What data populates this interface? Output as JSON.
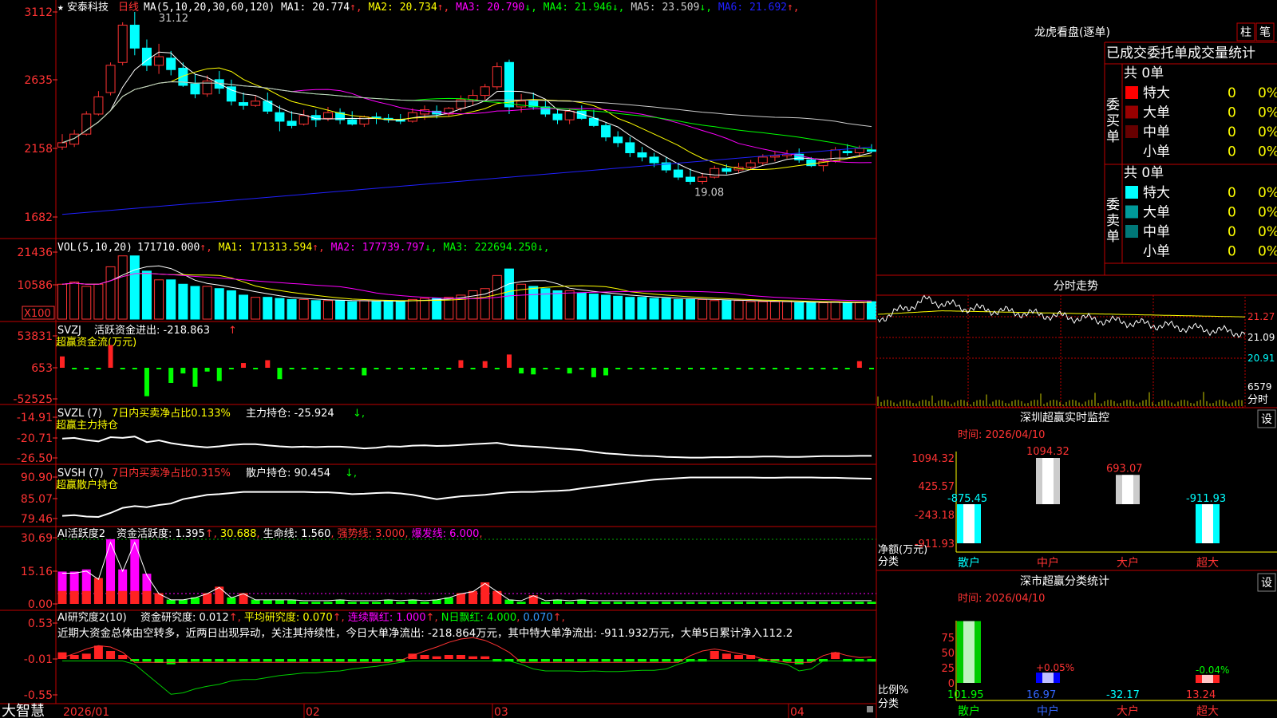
{
  "stock": {
    "star": "★",
    "name": "安泰科技",
    "period": "日线"
  },
  "price_panel": {
    "ma_label": "MA(5,10,20,30,60,120)",
    "ma_items": [
      {
        "text": "MA1: 20.774",
        "arrow": "↑",
        "color": "#ffffff"
      },
      {
        "text": "MA2: 20.734",
        "arrow": "↑",
        "color": "#ffff00"
      },
      {
        "text": "MA3: 20.790",
        "arrow": "↓",
        "color": "#ff00ff"
      },
      {
        "text": "MA4: 21.946",
        "arrow": "↓",
        "color": "#00ff00"
      },
      {
        "text": "MA5: 23.509",
        "arrow": "↓",
        "color": "#cccccc"
      },
      {
        "text": "MA6: 21.692",
        "arrow": "↑",
        "color": "#2020ff"
      }
    ],
    "y_ticks": [
      "3112",
      "2635",
      "2158",
      "1682"
    ],
    "high_label": "31.12",
    "low_label": "19.08"
  },
  "vol_panel": {
    "label": "VOL(5,10,20)",
    "items": [
      {
        "text": "171710.000",
        "arrow": "↑",
        "color": "#ffffff"
      },
      {
        "text": "MA1: 171313.594",
        "arrow": "↑",
        "color": "#ffff00"
      },
      {
        "text": "MA2: 177739.797",
        "arrow": "↓",
        "color": "#ff00ff"
      },
      {
        "text": "MA3: 222694.250",
        "arrow": "↓",
        "color": "#00ff00"
      }
    ],
    "y_ticks": [
      "21436",
      "10586"
    ],
    "unit": "X100"
  },
  "svzj_panel": {
    "label": "SVZJ",
    "text1": "活跃资金进出: -218.863",
    "arrow1": "↑",
    "title2": "超赢资金流(万元)",
    "y_ticks": [
      "53831",
      "653",
      "-52525"
    ]
  },
  "svzl_panel": {
    "label": "SVZL (7)",
    "text1": "7日内买卖净占比0.133%",
    "text2": "主力持仓: -25.924",
    "arrow2": "↓,",
    "title2": "超赢主力持仓",
    "y_ticks": [
      "-14.91",
      "-20.71",
      "-26.50"
    ]
  },
  "svsh_panel": {
    "label": "SVSH (7)",
    "text1": "7日内买卖净占比0.315%",
    "text2": "散户持仓: 90.454",
    "arrow2": "↓,",
    "title2": "超赢散户持仓",
    "y_ticks": [
      "90.90",
      "85.07",
      "79.46"
    ]
  },
  "ai_active_panel": {
    "label": "AI活跃度2",
    "items": [
      {
        "text": "资金活跃度: 1.395",
        "arrow": "↑",
        "color": "#ffffff"
      },
      {
        "text": "30.688",
        "arrow": "",
        "color": "#ffff00"
      },
      {
        "text": "生命线: 1.560",
        "arrow": "",
        "color": "#ffffff"
      },
      {
        "text": "强势线: 3.000",
        "arrow": "",
        "color": "#ff3333"
      },
      {
        "text": "爆发线: 6.000",
        "arrow": "",
        "color": "#ff00ff"
      }
    ],
    "y_ticks": [
      "30.69",
      "15.16",
      "0.00"
    ]
  },
  "ai_research_panel": {
    "label": "AI研究度2(10)",
    "items": [
      {
        "text": "资金研究度: 0.012",
        "arrow": "↑",
        "color": "#ffffff"
      },
      {
        "text": "平均研究度: 0.070",
        "arrow": "↑",
        "color": "#ffff00"
      },
      {
        "text": "连续飘红: 1.000",
        "arrow": "↑",
        "color": "#ff00ff"
      },
      {
        "text": "N日飘红: 4.000",
        "arrow": "",
        "color": "#00ff00"
      },
      {
        "text": "0.070",
        "arrow": "↑",
        "color": "#3399ff"
      }
    ],
    "comment": "近期大资金总体由空转多，近两日出现异动，关注其持续性，今日大单净流出: -218.864万元，其中特大单净流出: -911.932万元，大单5日累计净入112.2",
    "y_ticks": [
      "0.53",
      "-0.01",
      "-0.55"
    ]
  },
  "x_axis": {
    "labels": [
      "2026/01",
      "02",
      "03",
      "04"
    ]
  },
  "brand": "大智慧",
  "right_panel": {
    "lhb": {
      "title": "龙虎看盘(逐单)",
      "tab1": "柱",
      "tab2": "笔",
      "header": "已成交委托单成交量统计",
      "buy": {
        "side_label": "委买单",
        "total": "共 0单",
        "rows": [
          {
            "label": "特大",
            "count": "0",
            "pct": "0%",
            "color": "#ff0000"
          },
          {
            "label": "大单",
            "count": "0",
            "pct": "0%",
            "color": "#990000"
          },
          {
            "label": "中单",
            "count": "0",
            "pct": "0%",
            "color": "#660000"
          },
          {
            "label": "小单",
            "count": "0",
            "pct": "0%",
            "color": "#000000"
          }
        ]
      },
      "sell": {
        "side_label": "委卖单",
        "total": "共 0单",
        "rows": [
          {
            "label": "特大",
            "count": "0",
            "pct": "0%",
            "color": "#00ffff"
          },
          {
            "label": "大单",
            "count": "0",
            "pct": "0%",
            "color": "#009999"
          },
          {
            "label": "中单",
            "count": "0",
            "pct": "0%",
            "color": "#007777"
          },
          {
            "label": "小单",
            "count": "0",
            "pct": "0%",
            "color": "#000000"
          }
        ]
      }
    },
    "intraday": {
      "title": "分时走势",
      "y_ticks": [
        "21.27",
        "21.09",
        "20.91"
      ],
      "vol_label": "6579",
      "vol_title": "分时"
    },
    "sz_monitor": {
      "title": "深圳超赢实时监控",
      "setting": "设",
      "time": "时间: 2026/04/10",
      "y_ticks": [
        "1094.32",
        "425.57",
        "-243.18",
        "-911.93"
      ],
      "axis_title1": "净额(万元)",
      "axis_title2": "分类",
      "chart_data": {
        "type": "bar",
        "categories": [
          "散户",
          "中户",
          "大户",
          "超大"
        ],
        "values": [
          -875.45,
          1094.32,
          693.07,
          -911.93
        ],
        "value_labels": [
          "-875.45",
          "1094.32",
          "693.07",
          "-911.93"
        ],
        "ylim": [
          -911.93,
          1094.32
        ]
      }
    },
    "sz_class": {
      "title": "深市超赢分类统计",
      "setting": "设",
      "time": "时间: 2026/04/10",
      "y_ticks": [
        "75",
        "50",
        "25",
        "0"
      ],
      "axis_title1": "比例%",
      "axis_title2": "分类",
      "categories": [
        "散户",
        "中户",
        "大户",
        "超大"
      ],
      "bottom_values": [
        "101.95",
        "16.97",
        "-32.17",
        "13.24"
      ],
      "pct_labels": [
        "",
        "+0.05%",
        "",
        "-0.04%"
      ],
      "chart_data": {
        "type": "bar",
        "categories": [
          "散户",
          "中户",
          "大户",
          "超大"
        ],
        "values": [
          101.95,
          16.97,
          -32.17,
          13.24
        ],
        "ylim": [
          0,
          75
        ]
      }
    }
  },
  "chart_data": {
    "type": "candlestick",
    "x_labels": [
      "2026/01",
      "02",
      "03",
      "04"
    ],
    "ohlc": [
      [
        21.7,
        22.6,
        21.5,
        22.0
      ],
      [
        21.9,
        22.9,
        21.7,
        22.6
      ],
      [
        22.6,
        24.2,
        22.5,
        24.0
      ],
      [
        24.0,
        25.6,
        23.9,
        25.2
      ],
      [
        25.5,
        27.6,
        25.3,
        27.4
      ],
      [
        27.6,
        30.4,
        27.4,
        30.2
      ],
      [
        30.2,
        31.12,
        28.1,
        28.6
      ],
      [
        28.6,
        29.2,
        27.0,
        27.4
      ],
      [
        27.4,
        28.9,
        26.8,
        28.0
      ],
      [
        27.9,
        28.4,
        26.7,
        27.1
      ],
      [
        27.2,
        27.6,
        25.9,
        26.0
      ],
      [
        26.1,
        26.8,
        25.1,
        25.4
      ],
      [
        25.4,
        26.7,
        25.2,
        26.3
      ],
      [
        26.4,
        27.0,
        25.4,
        25.8
      ],
      [
        25.9,
        26.4,
        24.6,
        24.9
      ],
      [
        24.8,
        25.5,
        24.3,
        24.6
      ],
      [
        24.6,
        25.3,
        24.5,
        24.9
      ],
      [
        24.9,
        25.5,
        24.0,
        24.2
      ],
      [
        24.1,
        24.6,
        22.8,
        23.5
      ],
      [
        23.5,
        24.2,
        23.0,
        23.2
      ],
      [
        23.3,
        24.3,
        23.2,
        23.9
      ],
      [
        23.9,
        24.3,
        23.1,
        23.6
      ],
      [
        23.7,
        24.5,
        23.5,
        24.1
      ],
      [
        24.1,
        24.4,
        23.3,
        23.6
      ],
      [
        23.6,
        24.2,
        23.2,
        23.3
      ],
      [
        23.3,
        23.9,
        23.1,
        23.8
      ],
      [
        23.8,
        24.1,
        23.3,
        23.7
      ],
      [
        23.7,
        24.0,
        23.4,
        23.6
      ],
      [
        23.6,
        24.0,
        23.3,
        23.5
      ],
      [
        23.5,
        24.4,
        23.4,
        24.1
      ],
      [
        24.0,
        24.6,
        23.6,
        24.3
      ],
      [
        24.2,
        24.6,
        23.7,
        24.0
      ],
      [
        24.0,
        24.5,
        23.8,
        24.4
      ],
      [
        24.4,
        25.3,
        24.2,
        25.0
      ],
      [
        25.0,
        25.7,
        24.6,
        25.3
      ],
      [
        25.3,
        26.1,
        25.0,
        25.9
      ],
      [
        25.9,
        27.6,
        25.7,
        27.3
      ],
      [
        27.6,
        27.8,
        24.0,
        24.5
      ],
      [
        24.5,
        25.4,
        24.1,
        24.9
      ],
      [
        24.9,
        25.5,
        24.3,
        24.5
      ],
      [
        24.5,
        24.9,
        23.8,
        24.0
      ],
      [
        24.0,
        24.3,
        23.3,
        23.6
      ],
      [
        23.6,
        24.4,
        23.3,
        24.2
      ],
      [
        24.2,
        24.6,
        23.6,
        23.7
      ],
      [
        23.7,
        24.3,
        23.1,
        23.2
      ],
      [
        23.2,
        23.4,
        22.1,
        22.4
      ],
      [
        22.4,
        22.8,
        21.7,
        22.0
      ],
      [
        22.0,
        22.4,
        21.0,
        21.3
      ],
      [
        21.3,
        21.7,
        20.7,
        21.0
      ],
      [
        21.0,
        21.3,
        20.3,
        20.6
      ],
      [
        20.6,
        21.0,
        19.9,
        20.1
      ],
      [
        20.1,
        20.6,
        19.4,
        19.6
      ],
      [
        19.6,
        20.2,
        19.08,
        19.3
      ],
      [
        19.3,
        19.9,
        19.1,
        19.6
      ],
      [
        19.6,
        20.4,
        19.5,
        20.2
      ],
      [
        20.2,
        20.5,
        19.8,
        20.0
      ],
      [
        20.1,
        20.6,
        19.9,
        20.3
      ],
      [
        20.3,
        20.8,
        20.1,
        20.6
      ],
      [
        20.6,
        21.2,
        20.4,
        21.0
      ],
      [
        21.0,
        21.4,
        20.7,
        21.1
      ],
      [
        21.1,
        21.5,
        20.9,
        21.2
      ],
      [
        21.2,
        21.6,
        20.6,
        20.8
      ],
      [
        20.8,
        21.0,
        20.3,
        20.4
      ],
      [
        20.4,
        20.9,
        20.0,
        20.7
      ],
      [
        20.7,
        21.7,
        20.6,
        21.5
      ],
      [
        21.4,
        21.9,
        21.1,
        21.3
      ],
      [
        21.3,
        21.8,
        21.0,
        21.6
      ],
      [
        21.5,
        21.9,
        21.3,
        21.4
      ]
    ],
    "volume": [
      160,
      170,
      150,
      160,
      240,
      290,
      290,
      220,
      180,
      180,
      160,
      150,
      150,
      140,
      130,
      110,
      100,
      100,
      95,
      90,
      90,
      85,
      85,
      85,
      80,
      85,
      80,
      85,
      80,
      90,
      95,
      95,
      100,
      110,
      130,
      140,
      200,
      230,
      160,
      150,
      140,
      130,
      130,
      120,
      115,
      110,
      105,
      100,
      100,
      95,
      95,
      90,
      90,
      90,
      85,
      85,
      85,
      80,
      80,
      80,
      80,
      75,
      75,
      75,
      80,
      75,
      75,
      80
    ],
    "fund_flow": [
      60,
      -5,
      -5,
      -5,
      120,
      -5,
      -5,
      -150,
      -5,
      -80,
      -30,
      -100,
      -20,
      -70,
      -5,
      25,
      -5,
      40,
      -60,
      -5,
      -5,
      -5,
      -5,
      -5,
      -5,
      -40,
      -5,
      -5,
      -5,
      -5,
      -5,
      -5,
      -5,
      40,
      -5,
      35,
      -5,
      70,
      -30,
      -35,
      -5,
      -5,
      -30,
      -10,
      -50,
      -40,
      -5,
      -5,
      -5,
      -5,
      -5,
      -5,
      -5,
      -5,
      -5,
      -5,
      -5,
      -5,
      -5,
      -5,
      -5,
      -5,
      -5,
      -5,
      -5,
      -5,
      35,
      -5
    ],
    "ai_active": [
      15,
      15,
      16,
      12,
      30,
      16,
      30,
      14,
      5,
      2,
      2,
      3,
      5,
      8,
      3,
      5,
      2,
      2,
      2,
      2,
      1,
      1,
      1,
      2,
      1,
      1,
      1,
      2,
      1,
      2,
      1,
      2,
      3,
      5,
      6,
      10,
      6,
      2,
      1,
      4,
      1,
      2,
      1,
      2,
      1,
      1,
      1,
      1,
      1,
      1,
      1,
      1,
      1,
      1,
      1,
      1,
      1,
      1,
      1,
      1,
      1,
      1,
      1,
      1,
      1,
      1,
      1,
      1
    ]
  }
}
